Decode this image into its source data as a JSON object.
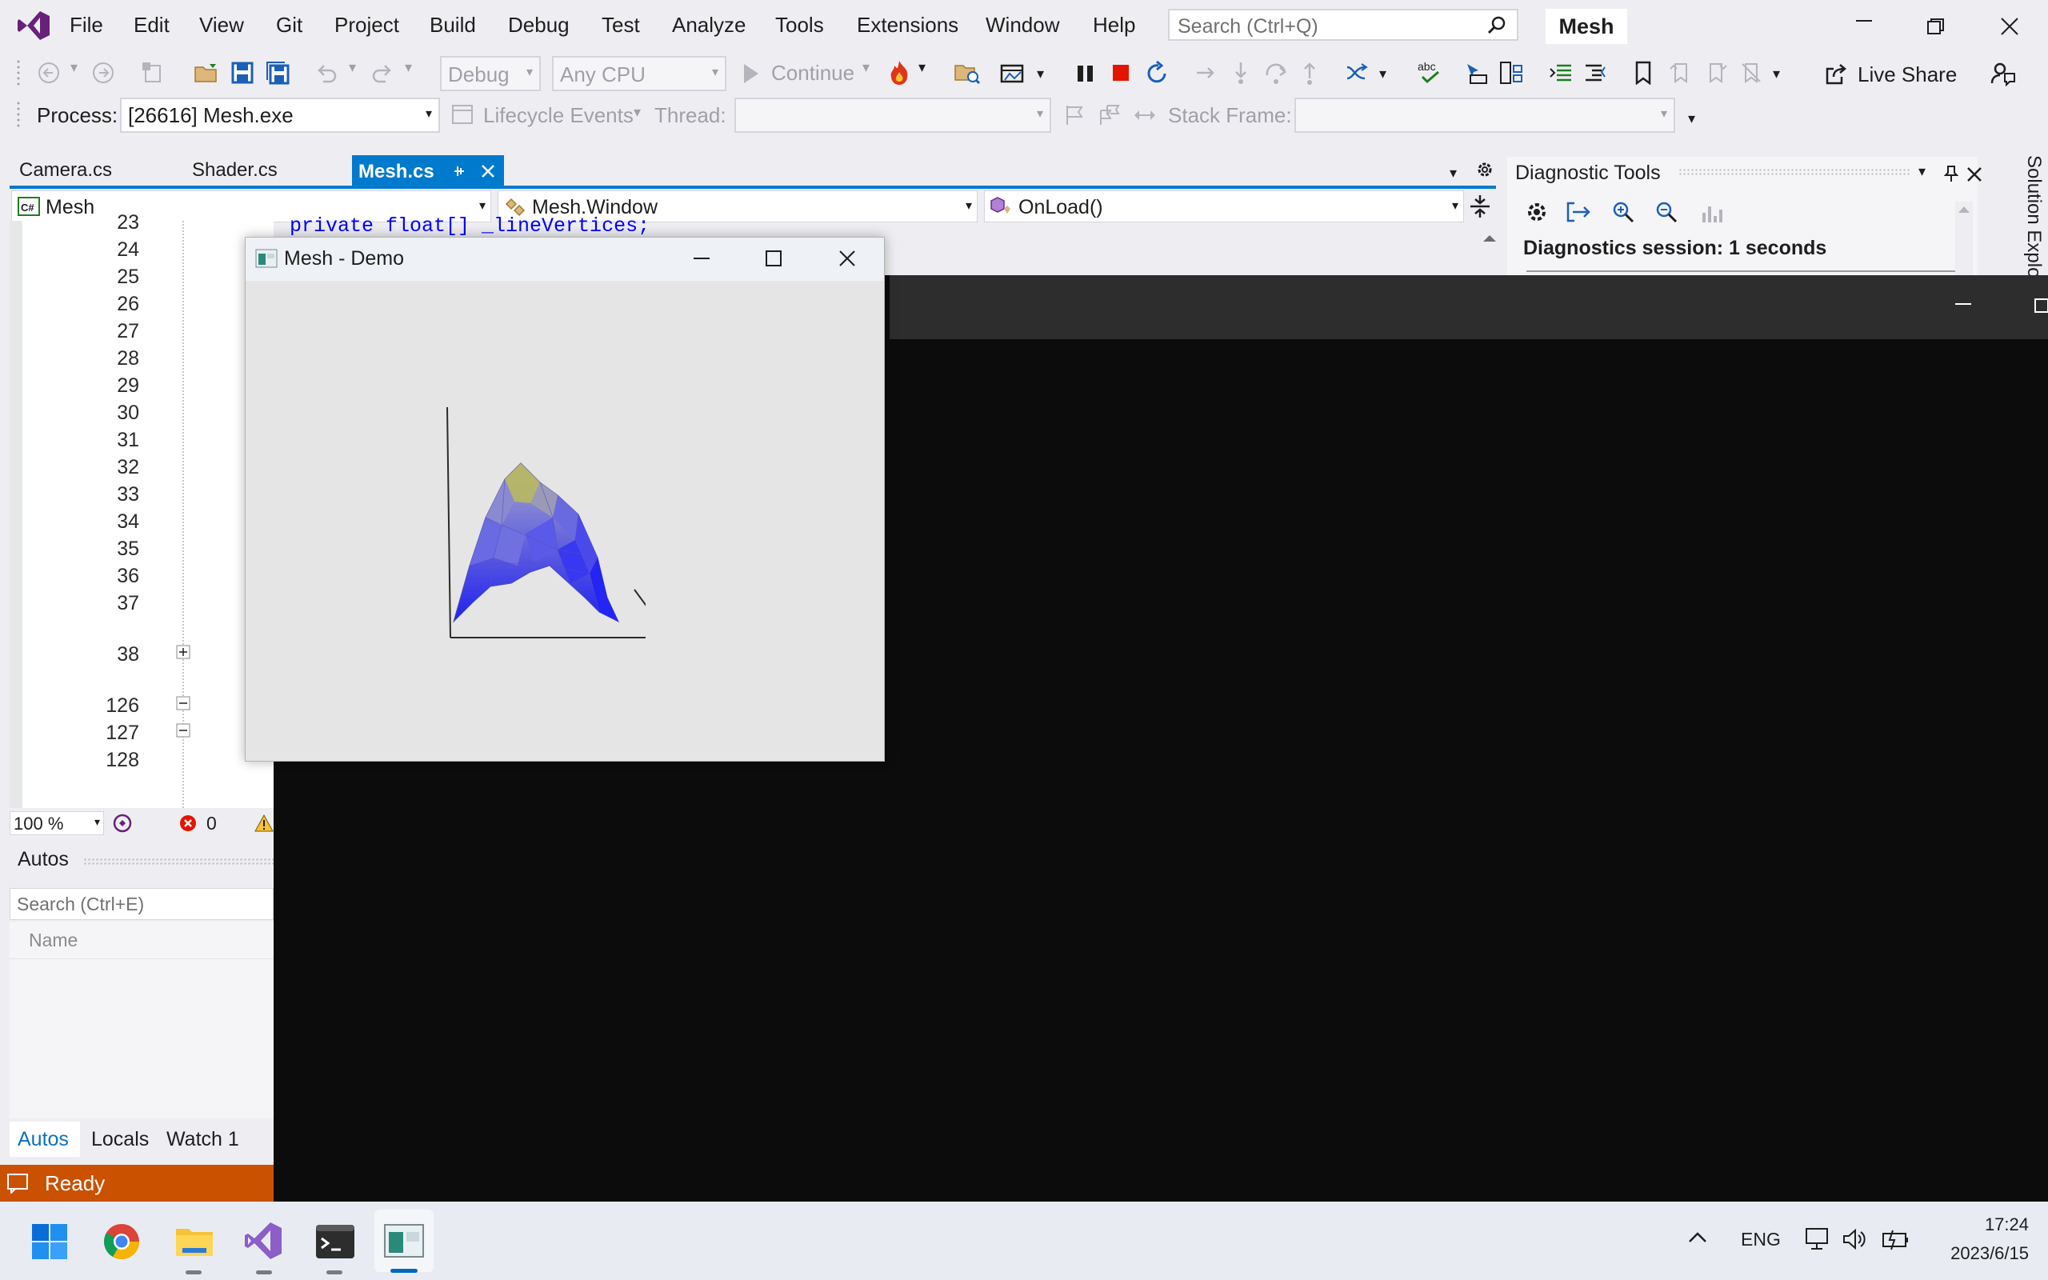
{
  "menubar": {
    "items": [
      "File",
      "Edit",
      "View",
      "Git",
      "Project",
      "Build",
      "Debug",
      "Test",
      "Analyze",
      "Tools",
      "Extensions",
      "Window",
      "Help"
    ],
    "search_placeholder": "Search (Ctrl+Q)",
    "solution_name": "Mesh"
  },
  "toolbar": {
    "config": "Debug",
    "platform": "Any CPU",
    "continue_label": "Continue",
    "live_share_label": "Live Share"
  },
  "debug_location": {
    "process_label": "Process:",
    "process_value": "[26616] Mesh.exe",
    "lifecycle_label": "Lifecycle Events",
    "thread_label": "Thread:",
    "stack_frame_label": "Stack Frame:"
  },
  "tabs": [
    {
      "label": "Camera.cs"
    },
    {
      "label": "Shader.cs"
    },
    {
      "label": "Mesh.cs",
      "active": true
    }
  ],
  "navbar": {
    "project": "Mesh",
    "type": "Mesh.Window",
    "member": "OnLoad()"
  },
  "editor": {
    "line_numbers": [
      "24",
      "25",
      "26",
      "27",
      "28",
      "29",
      "30",
      "31",
      "32",
      "33",
      "34",
      "35",
      "36",
      "37",
      "38",
      "126",
      "127",
      "128"
    ],
    "partial_top_line": "23",
    "partial_code": "private float[] _lineVertices;",
    "zoom": "100 %",
    "error_count": "0"
  },
  "diagnostics": {
    "title": "Diagnostic Tools",
    "session_text": "Diagnostics session: 1 seconds"
  },
  "side_tab": "Solution Explo",
  "autos": {
    "title": "Autos",
    "search_placeholder": "Search (Ctrl+E)",
    "column_name": "Name",
    "bottom_tabs": [
      "Autos",
      "Locals",
      "Watch 1"
    ]
  },
  "status": {
    "text": "Ready"
  },
  "demo_window": {
    "title": "Mesh - Demo"
  },
  "taskbar": {
    "language": "ENG",
    "time": "17:24",
    "date": "2023/6/15"
  },
  "colors": {
    "vs_purple": "#68217a",
    "accent_blue": "#007acc",
    "status_orange": "#ca5100",
    "mesh_blue": "#3030e8",
    "mesh_yellow": "#b8b860"
  }
}
